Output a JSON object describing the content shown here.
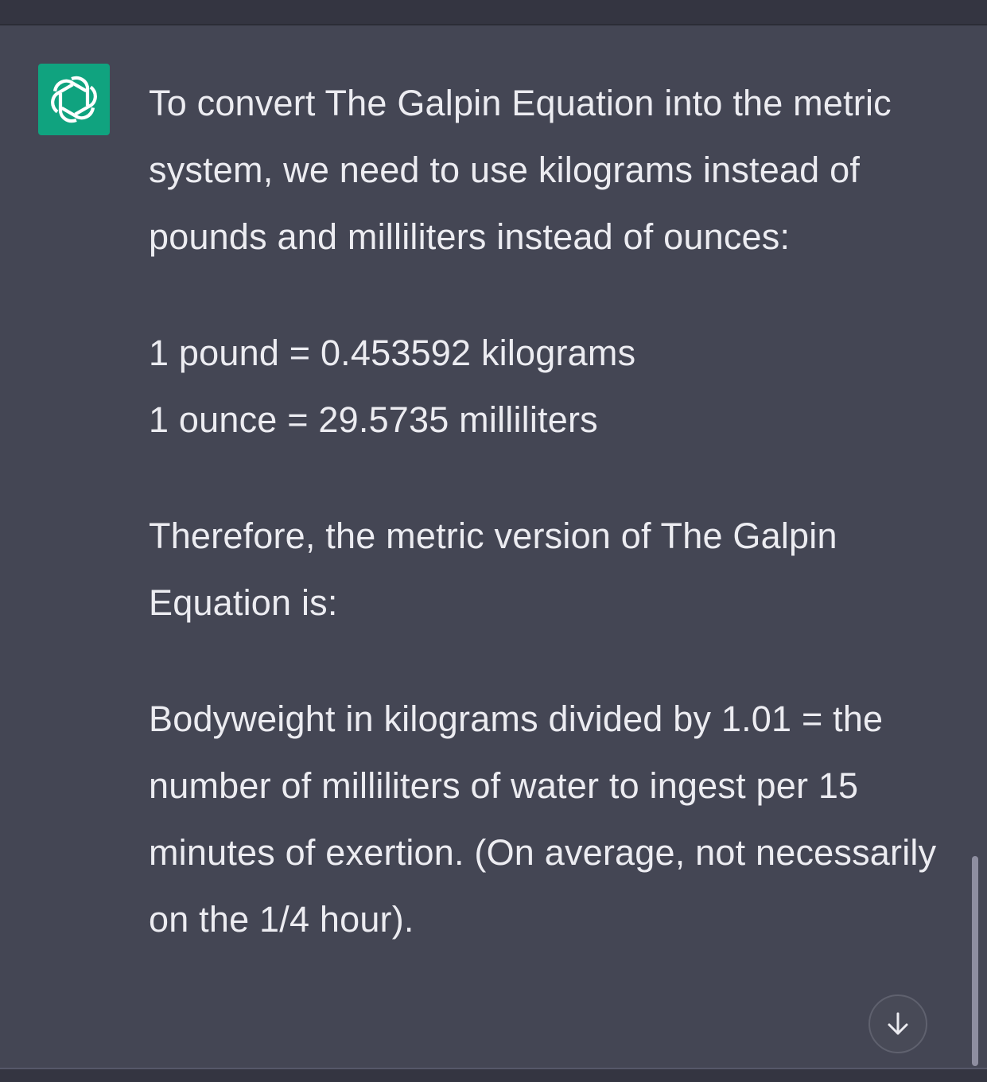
{
  "assistant": {
    "avatar_icon": "openai-logo-icon",
    "avatar_color": "#10a37f"
  },
  "message": {
    "paragraph_1": "To convert The Galpin Equation into the metric system, we need to use kilograms instead of pounds and milliliters instead of ounces:",
    "conversion_1": "1 pound = 0.453592 kilograms",
    "conversion_2": "1 ounce = 29.5735 milliliters",
    "paragraph_2": "Therefore, the metric version of The Galpin Equation is:",
    "paragraph_3": "Bodyweight in kilograms divided by 1.01 = the number of milliliters of water to ingest per 15 minutes of exertion. (On average, not necessarily on the 1/4 hour)."
  },
  "controls": {
    "scroll_down_icon": "arrow-down-icon"
  },
  "colors": {
    "page_background": "#343541",
    "message_background": "#444654",
    "text": "#ececf1",
    "scrollbar": "#8e8ea0"
  }
}
